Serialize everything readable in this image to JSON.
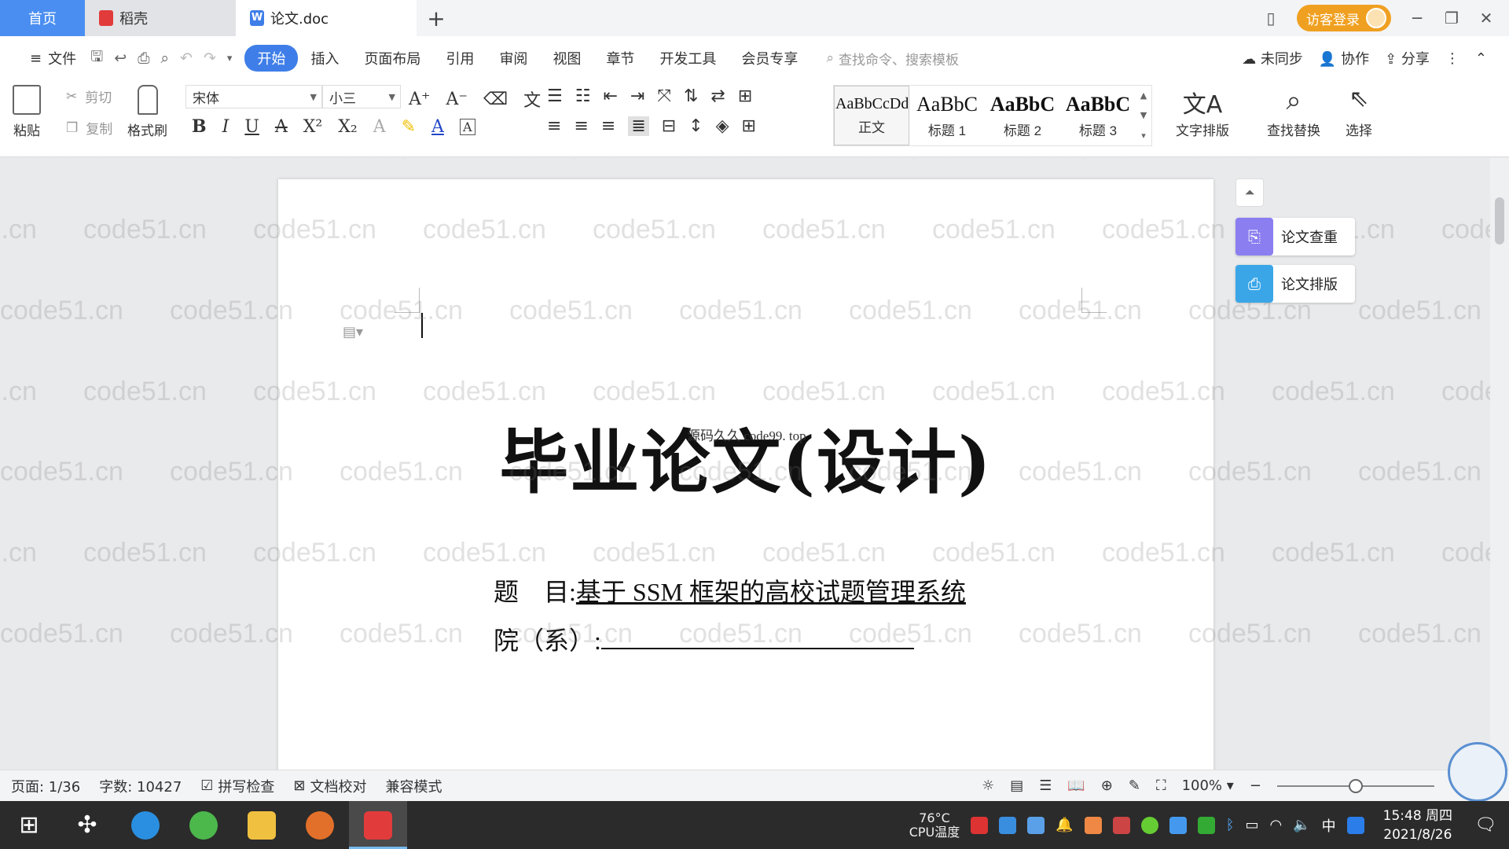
{
  "tabs": {
    "home": "首页",
    "daoke": "稻壳",
    "doc": "论文.doc",
    "add": "+"
  },
  "titlebar": {
    "login": "访客登录"
  },
  "menu": {
    "file": "文件",
    "items": [
      "开始",
      "插入",
      "页面布局",
      "引用",
      "审阅",
      "视图",
      "章节",
      "开发工具",
      "会员专享"
    ],
    "active": "开始",
    "search_placeholder": "查找命令、搜索模板",
    "unsync": "未同步",
    "collab": "协作",
    "share": "分享"
  },
  "ribbon": {
    "paste": "粘贴",
    "cut": "剪切",
    "copy": "复制",
    "format_painter": "格式刷",
    "font_name": "宋体",
    "font_size": "小三",
    "styles": [
      {
        "preview": "AaBbCcDd",
        "label": "正文"
      },
      {
        "preview": "AaBbC",
        "label": "标题 1"
      },
      {
        "preview": "AaBbC",
        "label": "标题 2"
      },
      {
        "preview": "AaBbC",
        "label": "标题 3"
      }
    ],
    "text_layout": "文字排版",
    "find_replace": "查找替换",
    "select": "选择"
  },
  "document": {
    "title": "毕业论文(设计)",
    "overlay_text": "源码久久 code99. top",
    "topic_label": "题    目:",
    "topic_value": "基于 SSM 框架的高校试题管理系统",
    "dept_label": "院（系）:"
  },
  "watermark": "code51.cn",
  "side_panel": {
    "check": "论文查重",
    "layout": "论文排版"
  },
  "status": {
    "page": "页面: 1/36",
    "words": "字数: 10427",
    "spell": "拼写检查",
    "proof": "文档校对",
    "compat": "兼容模式",
    "zoom": "100%",
    "zoom_level": 0.5
  },
  "taskbar": {
    "temp": "76°C",
    "temp_label": "CPU温度",
    "ime": "中",
    "time": "15:48 周四",
    "date": "2021/8/26"
  },
  "colors": {
    "accent": "#3f7ee8",
    "login": "#f0a020",
    "home_tab": "#4a8ef1"
  }
}
